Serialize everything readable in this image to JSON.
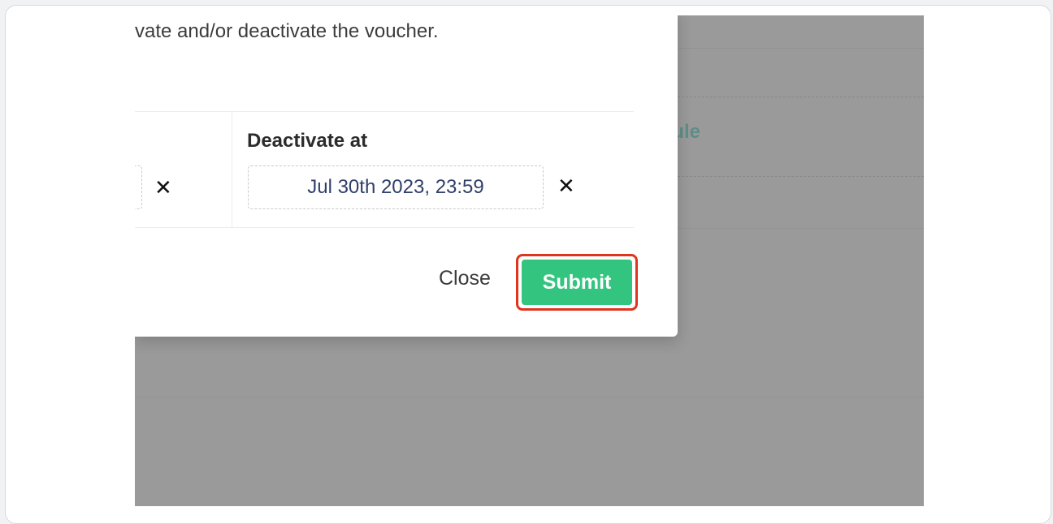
{
  "modal": {
    "description": "vate and/or deactivate the voucher.",
    "deactivate_label": "Deactivate at",
    "deactivate_value": "Jul 30th 2023, 23:59",
    "clear_glyph": "✕",
    "close_label": "Close",
    "submit_label": "Submit"
  },
  "background": {
    "link_fragment": "ule"
  },
  "colors": {
    "submit": "#33c47f",
    "highlight": "#e0341d",
    "overlay": "#9a9a9a"
  }
}
